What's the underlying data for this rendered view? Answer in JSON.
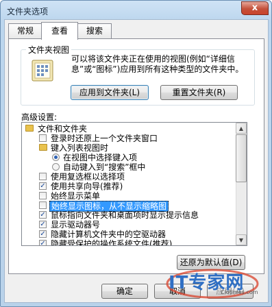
{
  "window": {
    "title": "文件夹选项",
    "close_label": "x"
  },
  "tabs": [
    {
      "label": "常规"
    },
    {
      "label": "查看"
    },
    {
      "label": "搜索"
    }
  ],
  "folder_views": {
    "legend": "文件夹视图",
    "description": "可以将该文件夹正在使用的视图(例如“详细信息”或“图标”)应用到所有这种类型的文件夹中。",
    "apply_button": "应用到文件夹(L)",
    "reset_button": "重置文件夹(R)"
  },
  "advanced": {
    "label": "高级设置:",
    "items": [
      {
        "text": "文件和文件夹",
        "kind": "folder",
        "level": 0
      },
      {
        "text": "登录时还原上一个文件夹窗口",
        "kind": "checkbox",
        "checked": false,
        "level": 1
      },
      {
        "text": "键入列表视图时",
        "kind": "folder",
        "level": 1
      },
      {
        "text": "在视图中选择键入项",
        "kind": "radio",
        "checked": true,
        "level": 2
      },
      {
        "text": "自动键入到“搜索”框中",
        "kind": "radio",
        "checked": false,
        "level": 2
      },
      {
        "text": "使用复选框以选择项",
        "kind": "checkbox",
        "checked": false,
        "level": 1
      },
      {
        "text": "使用共享向导(推荐)",
        "kind": "checkbox",
        "checked": true,
        "level": 1
      },
      {
        "text": "始终显示菜单",
        "kind": "checkbox",
        "checked": false,
        "level": 1
      },
      {
        "text": "始终显示图标，从不显示缩略图",
        "kind": "checkbox",
        "checked": false,
        "level": 1,
        "selected": true
      },
      {
        "text": "鼠标指向文件夹和桌面项时显示提示信息",
        "kind": "checkbox",
        "checked": true,
        "level": 1
      },
      {
        "text": "显示驱动器号",
        "kind": "checkbox",
        "checked": true,
        "level": 1
      },
      {
        "text": "隐藏计算机文件夹中的空驱动器",
        "kind": "checkbox",
        "checked": true,
        "level": 1
      },
      {
        "text": "隐藏受保护的操作系统文件(推荐)",
        "kind": "checkbox",
        "checked": true,
        "level": 1
      }
    ],
    "restore_button": "还原为默认值(D)"
  },
  "footer": {
    "ok": "确定",
    "cancel": "取消",
    "apply": "应用(A)"
  },
  "watermark": {
    "text": "IT专家网",
    "sub": "Ciotimes.com"
  },
  "colors": {
    "selection": "#3399ff",
    "titlebar": "#bcd6ee",
    "close": "#c4513b"
  }
}
